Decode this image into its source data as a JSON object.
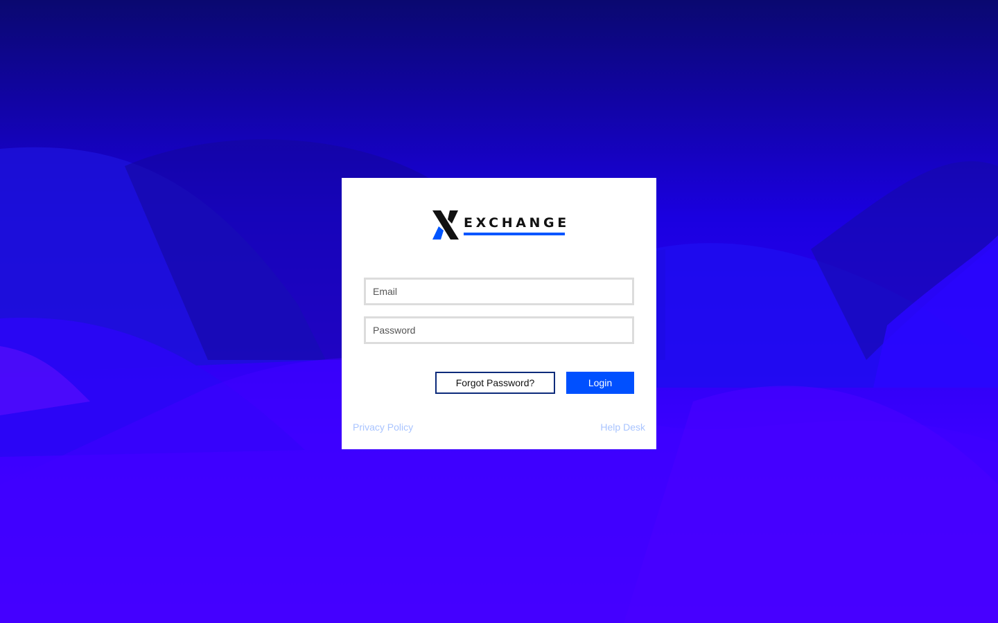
{
  "brand": {
    "name": "EXCHANGE",
    "logo_icon": "x-logo-icon",
    "accent_color": "#0050ff",
    "dark_color": "#111111"
  },
  "login_form": {
    "email_placeholder": "Email",
    "email_value": "",
    "password_placeholder": "Password",
    "password_value": "",
    "forgot_password_label": "Forgot Password?",
    "login_label": "Login"
  },
  "footer": {
    "privacy_label": "Privacy Policy",
    "help_label": "Help Desk"
  },
  "theme": {
    "background_top": "#0a0870",
    "background_bottom": "#4a00ff",
    "link_color": "#a9c4ff"
  }
}
